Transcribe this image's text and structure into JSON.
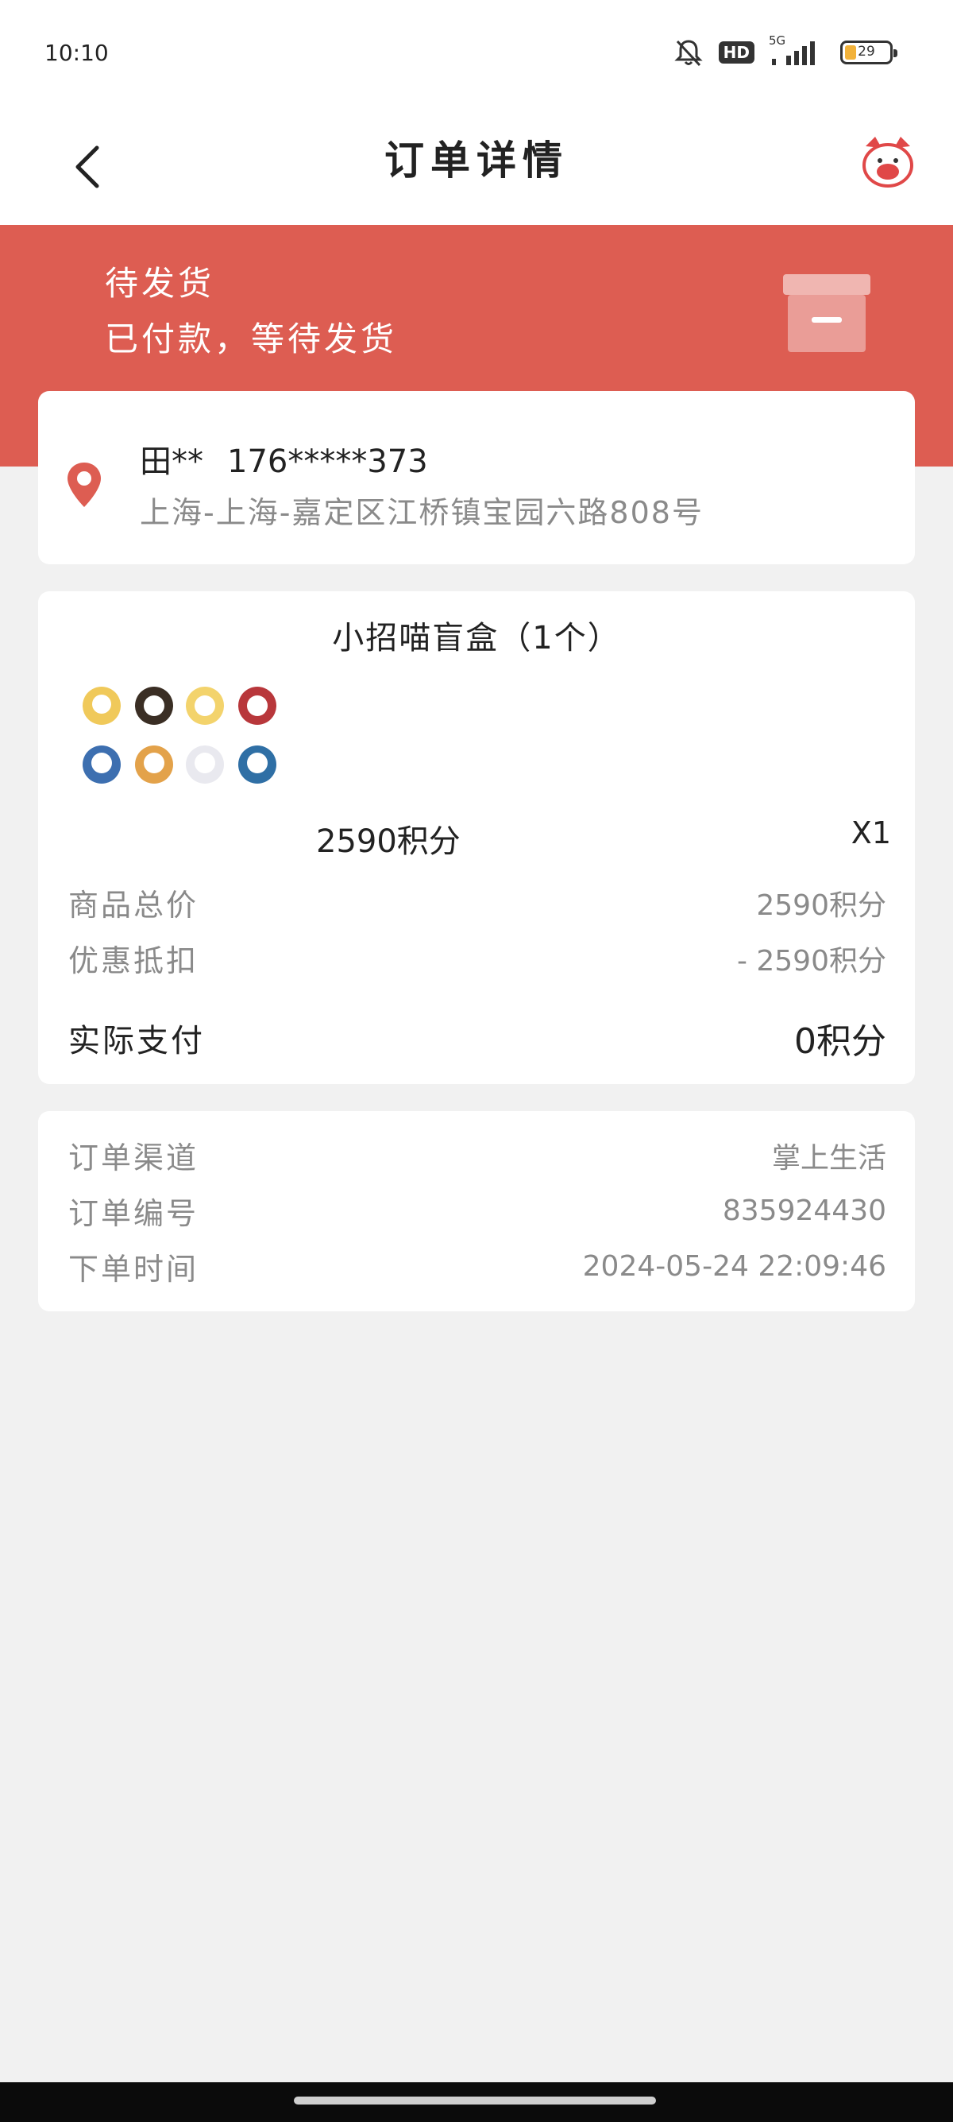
{
  "status_bar": {
    "time": "10:10",
    "hd_label": "HD",
    "network_label": "5G",
    "battery_level": "29"
  },
  "header": {
    "title": "订单详情",
    "back_icon": "chevron-left-icon",
    "mascot_icon": "cat-mascot-icon"
  },
  "status_banner": {
    "title": "待发货",
    "subtitle": "已付款，等待发货",
    "color": "#dd5d52"
  },
  "address": {
    "name": "田**",
    "phone": "176*****373",
    "detail": "上海-上海-嘉定区江桥镇宝园六路808号",
    "icon": "location-pin-icon"
  },
  "product": {
    "name": "小招喵盲盒（1个）",
    "price": "2590积分",
    "quantity": "X1"
  },
  "price_summary": {
    "rows": [
      {
        "label": "商品总价",
        "value": "2590积分"
      },
      {
        "label": "优惠抵扣",
        "value": "- 2590积分"
      }
    ],
    "total_label": "实际支付",
    "total_value": "0积分"
  },
  "order_info": {
    "rows": [
      {
        "label": "订单渠道",
        "value": "掌上生活"
      },
      {
        "label": "订单编号",
        "value": "835924430"
      },
      {
        "label": "下单时间",
        "value": "2024-05-24 22:09:46"
      }
    ]
  }
}
